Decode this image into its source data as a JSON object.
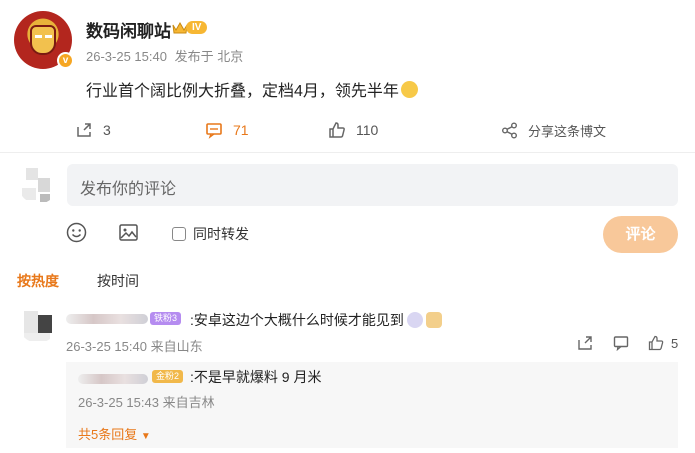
{
  "post": {
    "author": "数码闲聊站",
    "vip_level": "IV",
    "avatar_badge": "v",
    "timestamp": "26-3-25 15:40",
    "source": "发布于 北京",
    "content": "行业首个阔比例大折叠，定档4月，领先半年",
    "repost_count": "3",
    "comment_count": "71",
    "like_count": "110",
    "share_label": "分享这条博文"
  },
  "composer": {
    "placeholder": "发布你的评论",
    "repost_label": "同时转发",
    "submit_label": "评论"
  },
  "sort": {
    "hot": "按热度",
    "time": "按时间"
  },
  "comment": {
    "badge": "铁粉3",
    "text": ":安卓这边个大概什么时候才能见到",
    "timestamp": "26-3-25 15:40",
    "location": "来自山东",
    "like_count": "5",
    "reply": {
      "badge": "金粉2",
      "text": ":不是早就爆料 9 月米",
      "timestamp": "26-3-25 15:43",
      "location": "来自吉林"
    },
    "more_replies": "共5条回复"
  },
  "colors": {
    "accent": "#e8781a",
    "submit_disabled": "#f8c89a",
    "input_bg": "#f2f3f5",
    "fan_purple": "#b58cf0",
    "fan_gold": "#f1b84a"
  }
}
